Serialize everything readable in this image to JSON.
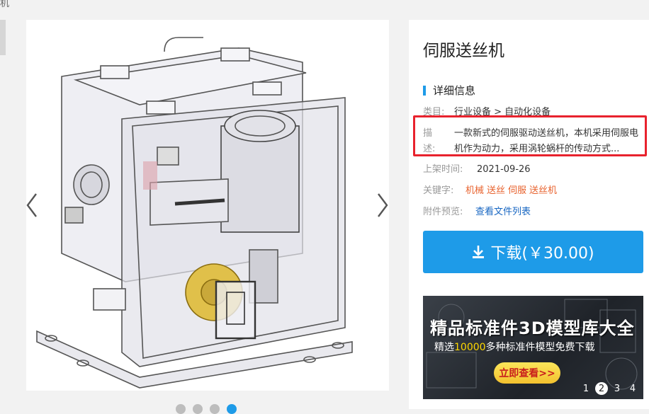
{
  "breadcrumb_fragment": "机",
  "gallery": {
    "image_alt": "伺服送丝机 3D model render",
    "prev_icon": "chevron-left-icon",
    "next_icon": "chevron-right-icon",
    "dots": [
      {
        "active": false
      },
      {
        "active": false
      },
      {
        "active": false
      },
      {
        "active": true
      }
    ]
  },
  "product": {
    "title": "伺服送丝机",
    "section_title": "详细信息",
    "category_label": "类目:",
    "category_value": "行业设备 > 自动化设备",
    "desc_label": "描述:",
    "desc_text": "一款新式的伺服驱动送丝机，本机采用伺服电机作为动力，采用涡轮蜗杆的传动方式...",
    "date_label": "上架时间:",
    "date_value": "2021-09-26",
    "keywords_label": "关键字:",
    "keywords": [
      "机械",
      "送丝",
      "伺服",
      "送丝机"
    ],
    "attachment_label": "附件预览:",
    "attachment_link": "查看文件列表",
    "download_label": "下载(￥30.00)"
  },
  "banner": {
    "title": "精品标准件3D模型库大全",
    "sub_prefix": "精选",
    "sub_highlight": "10000",
    "sub_suffix": "多种标准件模型免费下载",
    "button": "立即查看>>",
    "pages": [
      "1",
      "2",
      "3",
      "4"
    ],
    "active_page": "2"
  },
  "colors": {
    "accent": "#1e9be8",
    "highlight_border": "#e8222d",
    "keyword": "#e8622d",
    "link": "#1766c2"
  }
}
